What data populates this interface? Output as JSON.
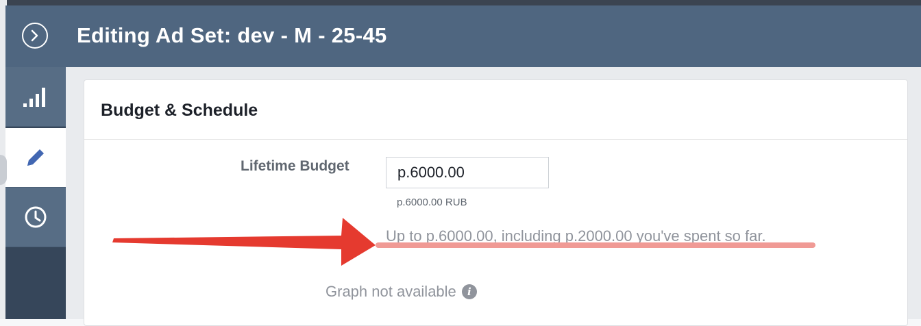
{
  "header": {
    "title": "Editing Ad Set: dev - M - 25-45",
    "back_icon": "chevron-right-circle-icon",
    "background_color": "#4f6680"
  },
  "sidebar": {
    "items": [
      {
        "icon": "bar-chart-icon",
        "active": false
      },
      {
        "icon": "pencil-icon",
        "active": true
      },
      {
        "icon": "clock-icon",
        "active": false
      }
    ],
    "accent_color": "#4267b2"
  },
  "budget_section": {
    "title": "Budget & Schedule",
    "lifetime_budget_label": "Lifetime Budget",
    "lifetime_budget_value": "p.6000.00",
    "currency_note": "p.6000.00 RUB",
    "spend_note": "Up to p.6000.00, including p.2000.00 you've spent so far.",
    "graph_note": "Graph not available",
    "info_icon": "info-icon"
  },
  "annotation": {
    "arrow_color": "#e53a2f",
    "underline_color": "#f09a95"
  }
}
